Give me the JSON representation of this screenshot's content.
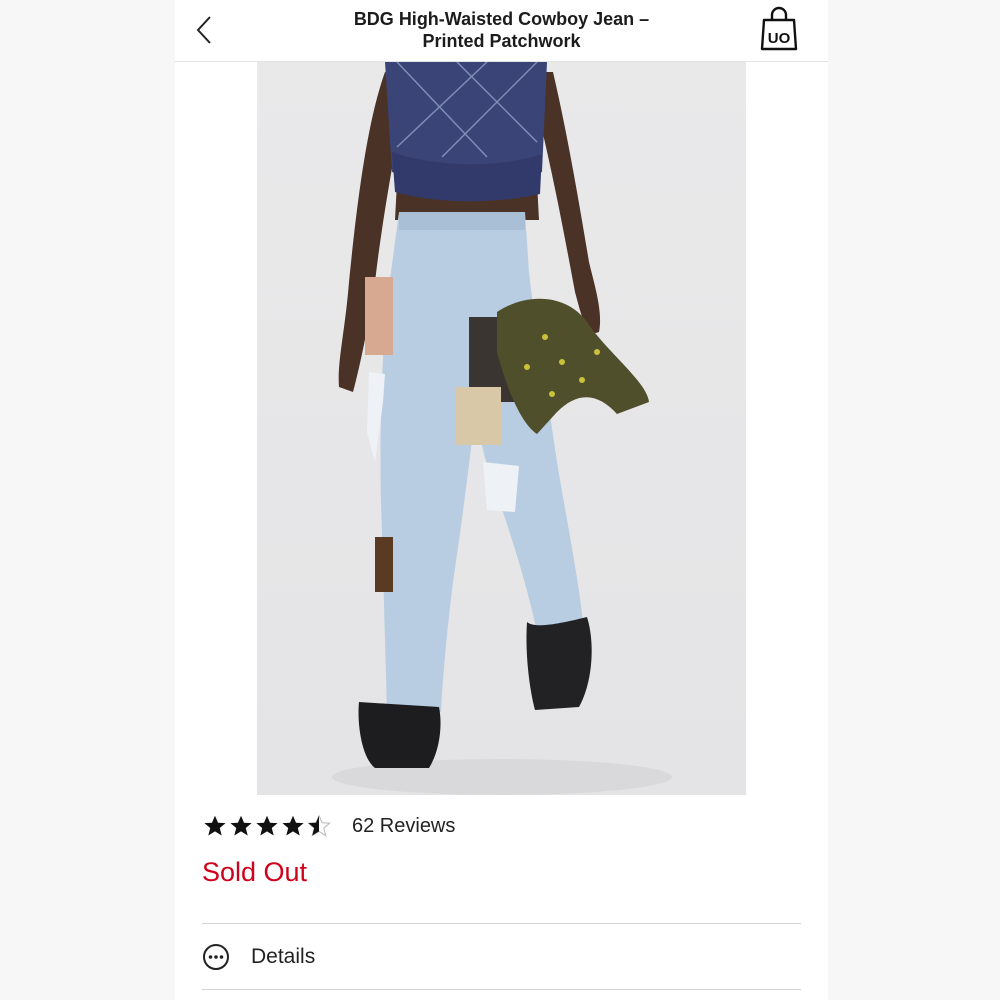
{
  "header": {
    "title_line1": "BDG High-Waisted Cowboy Jean –",
    "title_line2": "Printed Patchwork",
    "back_icon": "chevron-left-icon",
    "bag_icon": "uo-bag-icon",
    "bag_text": "UO"
  },
  "product": {
    "image_alt": "Model wearing light wash patchwork jeans with a navy argyle cropped vest, holding an olive jacket",
    "rating": 4.5,
    "rating_max": 5,
    "reviews_label": "62 Reviews",
    "status": "Sold Out"
  },
  "sections": {
    "details_label": "Details",
    "details_icon": "more-horizontal-circle-icon"
  },
  "colors": {
    "sold_out": "#d0021b",
    "text": "#222222"
  }
}
